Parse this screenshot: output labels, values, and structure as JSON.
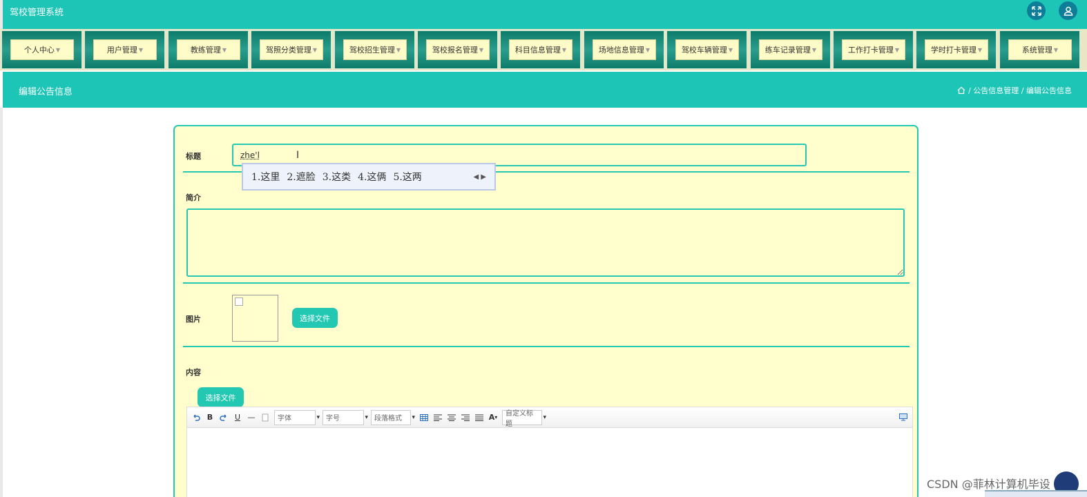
{
  "app": {
    "title": "驾校管理系统"
  },
  "nav": {
    "items": [
      {
        "label": "个人中心"
      },
      {
        "label": "用户管理"
      },
      {
        "label": "教练管理"
      },
      {
        "label": "驾照分类管理"
      },
      {
        "label": "驾校招生管理"
      },
      {
        "label": "驾校报名管理"
      },
      {
        "label": "科目信息管理"
      },
      {
        "label": "场地信息管理"
      },
      {
        "label": "驾校车辆管理"
      },
      {
        "label": "练车记录管理"
      },
      {
        "label": "工作打卡管理"
      },
      {
        "label": "学时打卡管理"
      },
      {
        "label": "系统管理"
      }
    ]
  },
  "header": {
    "page_title": "编辑公告信息",
    "breadcrumb": "/ 公告信息管理 / 编辑公告信息"
  },
  "form": {
    "title_label": "标题",
    "title_value": "zhe'l",
    "ime_candidates": [
      "1.这里",
      "2.遮脸",
      "3.这类",
      "4.这俩",
      "5.这两"
    ],
    "intro_label": "简介",
    "intro_value": "",
    "image_label": "图片",
    "choose_file": "选择文件",
    "content_label": "内容",
    "content_choose_file": "选择文件"
  },
  "editor": {
    "toolbar": {
      "bold": "B",
      "underline": "U",
      "hr": "—",
      "font": "字体",
      "size": "字号",
      "paragraph": "段落格式",
      "color": "A",
      "custom_title": "自定义标题"
    }
  },
  "watermark": "CSDN @菲林计算机毕设",
  "colors": {
    "primary": "#1cc5b5",
    "panel": "#fffecc",
    "nav_btn": "#fffcc8",
    "nav_bg": "#0d7b6a"
  },
  "icons": [
    "fullscreen-icon",
    "user-icon",
    "home-icon",
    "undo-icon",
    "redo-icon",
    "page-icon",
    "table-icon",
    "align-left-icon",
    "align-center-icon",
    "align-right-icon",
    "justify-icon",
    "monitor-icon"
  ]
}
